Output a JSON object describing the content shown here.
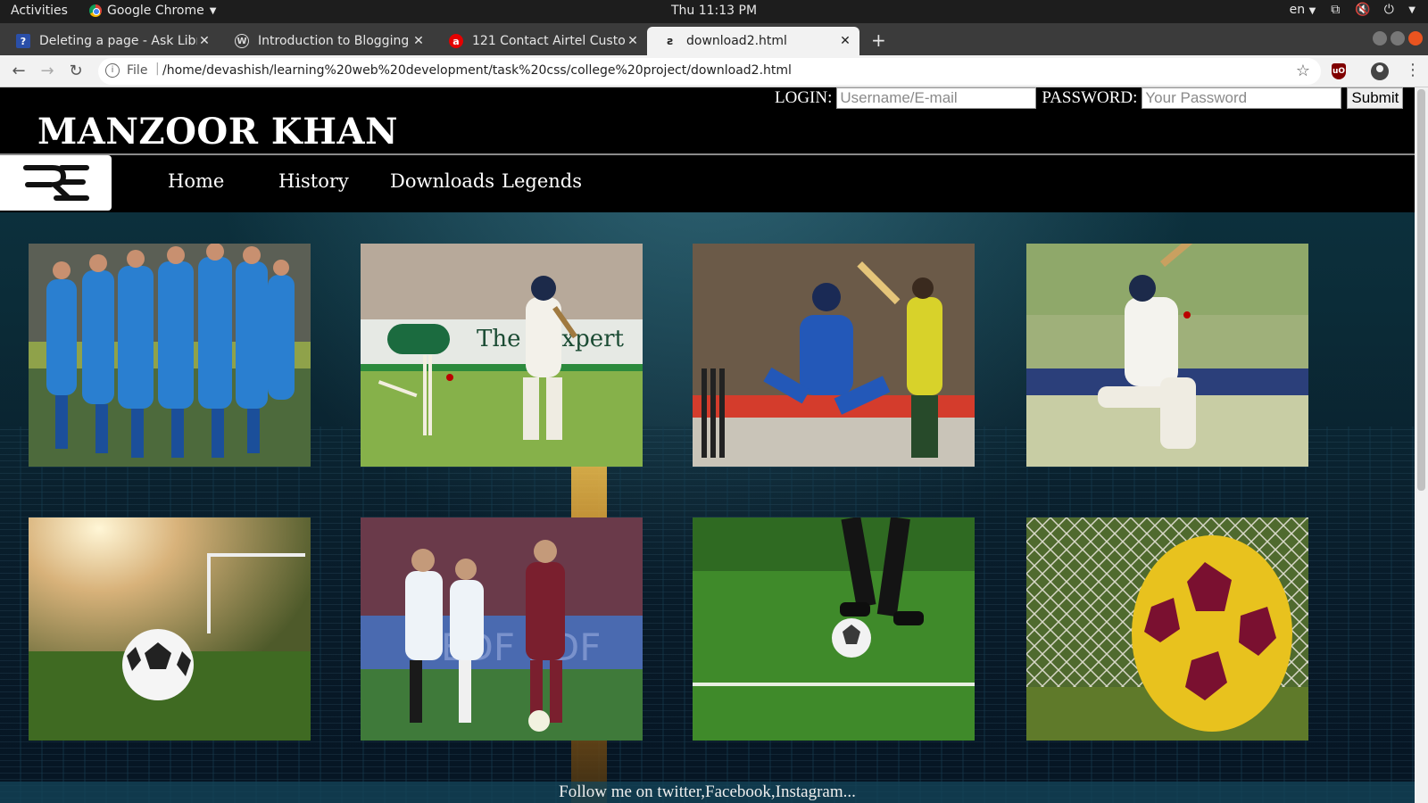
{
  "os_bar": {
    "activities": "Activities",
    "app_name": "Google Chrome",
    "clock": "Thu 11:13 PM",
    "lang": "en"
  },
  "browser": {
    "tabs": [
      {
        "title": "Deleting a page - Ask Libr",
        "favicon": "ask-library-icon",
        "active": false
      },
      {
        "title": "Introduction to Blogging",
        "favicon": "wordpress-icon",
        "active": false
      },
      {
        "title": "121 Contact Airtel Custon",
        "favicon": "airtel-icon",
        "active": false
      },
      {
        "title": "download2.html",
        "favicon": "page-logo-icon",
        "active": true
      }
    ],
    "address": {
      "scheme": "File",
      "url": "/home/devashish/learning%20web%20development/task%20css/college%20project/download2.html"
    }
  },
  "page": {
    "brand": "MANZOOR KHAN",
    "login": {
      "login_label": "LOGIN:",
      "username_placeholder": "Username/E-mail",
      "password_label": "PASSWORD:",
      "password_placeholder": "Your Password",
      "submit_label": "Submit"
    },
    "logo_text": "RE",
    "nav": [
      "Home",
      "History",
      "Downloads",
      "Legends"
    ],
    "photos": [
      {
        "name": "photo-cricket-team-celebration",
        "subject": "cricket team celebrating"
      },
      {
        "name": "photo-cricket-batsman-bowled",
        "subject": "batsman bowled, stumps broken"
      },
      {
        "name": "photo-cricket-batsman-shot",
        "subject": "batsman playing a shot"
      },
      {
        "name": "photo-cricket-batsman-kneeling",
        "subject": "batsman kneeling shot"
      },
      {
        "name": "photo-football-on-grass",
        "subject": "football on grass at sunset"
      },
      {
        "name": "photo-womens-football-match",
        "subject": "women's football match"
      },
      {
        "name": "photo-football-player-feet",
        "subject": "player dribbling football"
      },
      {
        "name": "photo-yellow-football-net",
        "subject": "yellow football in net"
      }
    ],
    "footer": "Follow me on twitter,Facebook,Instagram..."
  },
  "colors": {
    "header_bg": "#000000",
    "page_bg": "#0e3542",
    "accent_ubuntu": "#e95420"
  }
}
